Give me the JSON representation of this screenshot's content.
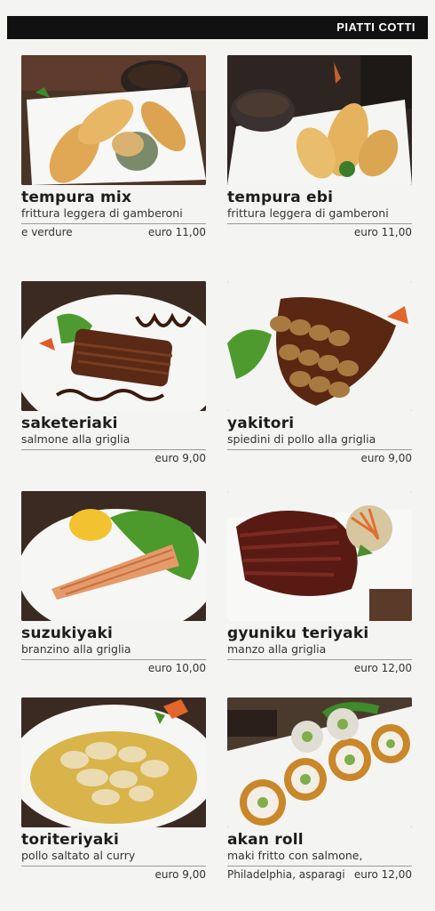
{
  "header": {
    "title": "PIATTI COTTI"
  },
  "items": [
    {
      "name": "tempura mix",
      "desc": "frittura leggera di gamberoni",
      "extra": "e verdure",
      "price": "euro 11,00"
    },
    {
      "name": "tempura ebi",
      "desc": "frittura leggera di gamberoni",
      "extra": "",
      "price": "euro 11,00"
    },
    {
      "name": "saketeriaki",
      "desc": "salmone alla griglia",
      "extra": "",
      "price": "euro 9,00"
    },
    {
      "name": "yakitori",
      "desc": "spiedini di pollo alla griglia",
      "extra": "",
      "price": "euro 9,00"
    },
    {
      "name": "suzukiyaki",
      "desc": "branzino alla griglia",
      "extra": "",
      "price": "euro 10,00"
    },
    {
      "name": "gyuniku teriyaki",
      "desc": "manzo alla griglia",
      "extra": "",
      "price": "euro 12,00"
    },
    {
      "name": "toriteriyaki",
      "desc": "pollo saltato al curry",
      "extra": "",
      "price": "euro 9,00"
    },
    {
      "name": "akan roll",
      "desc": "maki fritto con salmone,",
      "extra": "Philadelphia, asparagi",
      "price": "euro 12,00"
    }
  ]
}
